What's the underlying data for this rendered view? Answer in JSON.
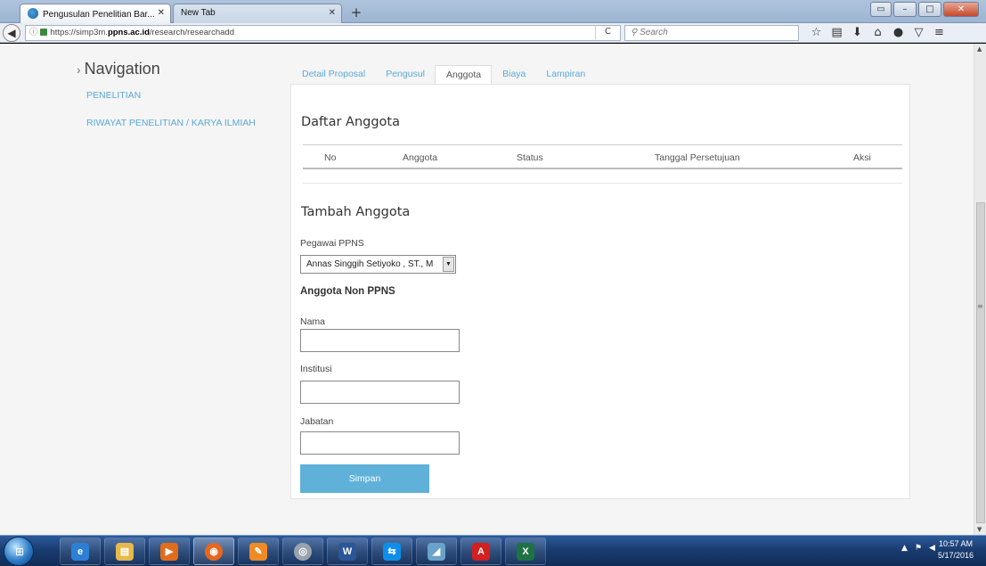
{
  "browser": {
    "tabs": [
      {
        "title": "Pengusulan Penelitian Bar...",
        "active": true
      },
      {
        "title": "New Tab",
        "active": false
      }
    ],
    "url_prefix": "https://simp3m.",
    "url_host": "ppns.ac.id",
    "url_path": "/research/researchadd",
    "search_placeholder": "Search"
  },
  "sidebar": {
    "title": "Navigation",
    "links": [
      "PENELITIAN",
      "RIWAYAT PENELITIAN / KARYA ILMIAH"
    ]
  },
  "page_tabs": [
    "Detail Proposal",
    "Pengusul",
    "Anggota",
    "Biaya",
    "Lampiran"
  ],
  "active_tab": "Anggota",
  "daftar": {
    "title": "Daftar Anggota",
    "columns": [
      "No",
      "Anggota",
      "Status",
      "Tanggal Persetujuan",
      "Aksi"
    ]
  },
  "tambah": {
    "title": "Tambah Anggota",
    "pegawai_label": "Pegawai PPNS",
    "pegawai_value": "Annas Singgih Setiyoko , ST., M",
    "non_ppns_label": "Anggota Non PPNS",
    "nama_label": "Nama",
    "institusi_label": "Institusi",
    "jabatan_label": "Jabatan",
    "save_label": "Simpan"
  },
  "taskbar": {
    "time": "10:57 AM",
    "date": "5/17/2016"
  },
  "colors": {
    "link": "#5aa9d6",
    "button": "#5fb1d9",
    "taskbar": "#183a6d"
  }
}
